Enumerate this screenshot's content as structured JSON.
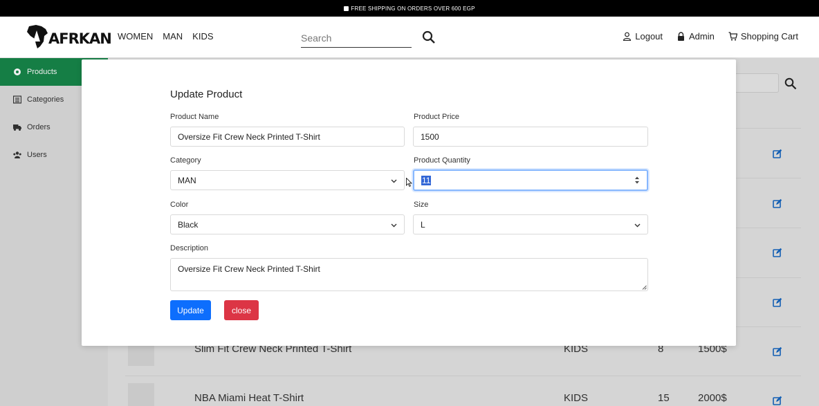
{
  "topbar": {
    "text": "FREE SHIPPING ON ORDERS OVER 600 EGP"
  },
  "brand": {
    "name": "AFRKAN"
  },
  "nav": {
    "women": "WOMEN",
    "man": "MAN",
    "kids": "KIDS"
  },
  "search": {
    "placeholder": "Search"
  },
  "account": {
    "logout": "Logout",
    "admin": "Admin",
    "cart": "Shopping Cart"
  },
  "sidebar": {
    "items": [
      {
        "label": "Products",
        "icon": "product-icon",
        "active": true
      },
      {
        "label": "Categories",
        "icon": "list-icon"
      },
      {
        "label": "Orders",
        "icon": "truck-icon"
      },
      {
        "label": "Users",
        "icon": "users-icon"
      }
    ]
  },
  "table": {
    "rows": [
      {
        "name": "Slim Fit Crew Neck Printed T-Shirt",
        "category": "KIDS",
        "quantity": "8",
        "price": "1500$"
      },
      {
        "name": "NBA Miami Heat T-Shirt",
        "category": "KIDS",
        "quantity": "15",
        "price": "2000$"
      }
    ]
  },
  "modal": {
    "title": "Update Product",
    "product_name_label": "Product Name",
    "product_name_value": "Oversize Fit Crew Neck Printed T-Shirt",
    "price_label": "Product Price",
    "price_value": "1500",
    "category_label": "Category",
    "category_value": "MAN",
    "quantity_label": "Product Quantity",
    "quantity_value": "11",
    "color_label": "Color",
    "color_value": "Black",
    "size_label": "Size",
    "size_value": "L",
    "description_label": "Description",
    "description_value": "Oversize Fit Crew Neck Printed T-Shirt",
    "update_label": "Update",
    "close_label": "close"
  },
  "colors": {
    "primary": "#0d6efd",
    "danger": "#dc3545",
    "sidebar_active": "#17864a"
  }
}
